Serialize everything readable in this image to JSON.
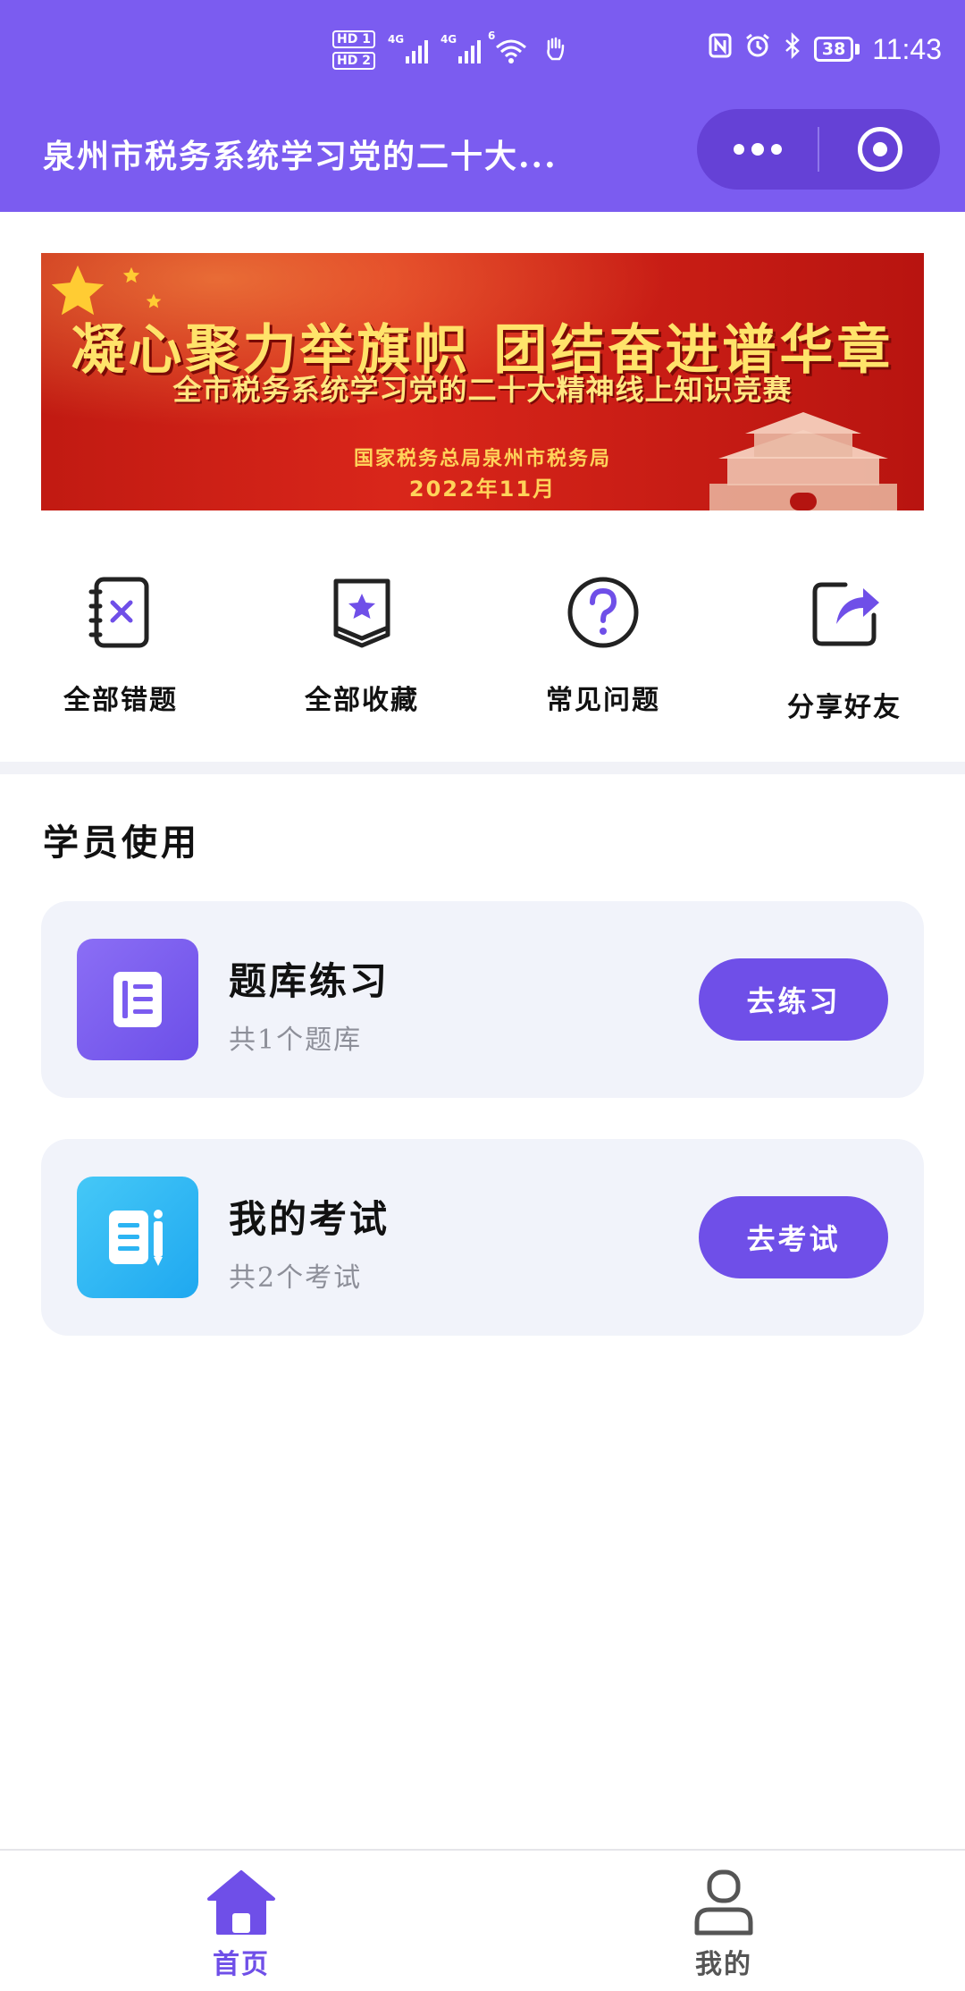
{
  "status_bar": {
    "hd1": "HD 1",
    "hd2": "HD 2",
    "net1": "4G",
    "net2": "4G",
    "wifi_badge": "6",
    "battery": "38",
    "time": "11:43"
  },
  "header": {
    "title": "泉州市税务系统学习党的二十大...",
    "accent": "#7b5cf0"
  },
  "banner": {
    "slogan": "凝心聚力举旗帜  团结奋进谱华章",
    "subtitle": "全市税务系统学习党的二十大精神线上知识竞赛",
    "org": "国家税务总局泉州市税务局",
    "date": "2022年11月"
  },
  "quick_actions": [
    {
      "label": "全部错题",
      "icon": "wrong-questions-notebook-icon"
    },
    {
      "label": "全部收藏",
      "icon": "bookmark-star-icon"
    },
    {
      "label": "常见问题",
      "icon": "question-circle-icon"
    },
    {
      "label": "分享好友",
      "icon": "share-arrow-icon"
    }
  ],
  "section": {
    "title": "学员使用"
  },
  "cards": [
    {
      "title": "题库练习",
      "subtitle": "共1个题库",
      "button": "去练习",
      "icon": "question-bank-icon"
    },
    {
      "title": "我的考试",
      "subtitle": "共2个考试",
      "button": "去考试",
      "icon": "exam-document-icon"
    }
  ],
  "tabbar": {
    "items": [
      {
        "label": "首页",
        "icon": "home-icon",
        "active": true
      },
      {
        "label": "我的",
        "icon": "user-icon",
        "active": false
      }
    ],
    "active_color": "#6f4fe8"
  }
}
